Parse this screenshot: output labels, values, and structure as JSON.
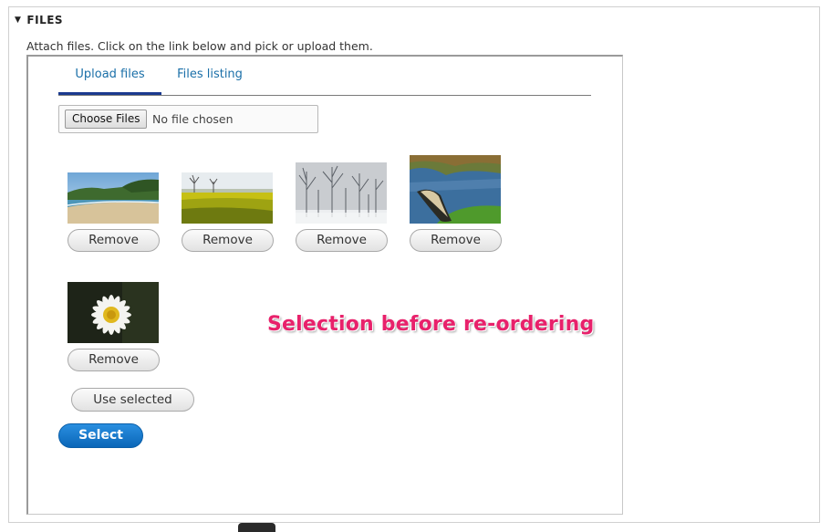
{
  "fieldset": {
    "legend": "FILES",
    "description": "Attach files. Click on the link below and pick or upload them."
  },
  "tabs": [
    {
      "label": "Upload files",
      "active": true
    },
    {
      "label": "Files listing",
      "active": false
    }
  ],
  "file_input": {
    "button_label": "Choose Files",
    "status_text": "No file chosen"
  },
  "images": [
    {
      "subject": "beach",
      "remove_label": "Remove"
    },
    {
      "subject": "yellow field",
      "remove_label": "Remove"
    },
    {
      "subject": "snowy forest",
      "remove_label": "Remove"
    },
    {
      "subject": "canoe on lake",
      "remove_label": "Remove"
    },
    {
      "subject": "daisy",
      "remove_label": "Remove"
    }
  ],
  "actions": {
    "use_selected_label": "Use selected",
    "select_label": "Select"
  },
  "annotation": {
    "text": "Selection before re-ordering",
    "color": "#e8216b"
  },
  "colors": {
    "link": "#1a6fa8",
    "active_tab_underline": "#1a3a8f",
    "primary_button": "#0a66b8"
  }
}
